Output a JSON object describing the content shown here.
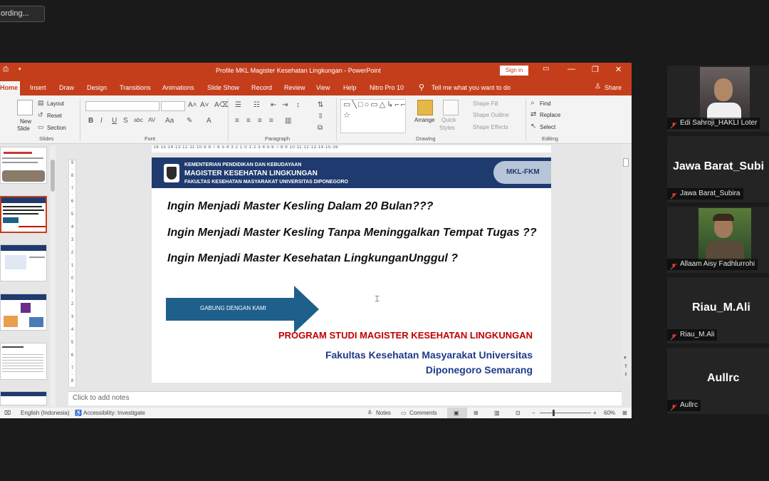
{
  "recording": {
    "label": "ording..."
  },
  "window": {
    "title": "Profile MKL Magister Kesehatan Lingkungan  -  PowerPoint",
    "signin": "Sign in"
  },
  "tabs": [
    "Home",
    "Insert",
    "Draw",
    "Design",
    "Transitions",
    "Animations",
    "Slide Show",
    "Record",
    "Review",
    "View",
    "Help",
    "Nitro Pro 10"
  ],
  "tell_me": "Tell me what you want to do",
  "share": "Share",
  "ribbon": {
    "slides_group": "Slides",
    "new_slide": "New",
    "new_slide2": "Slide",
    "layout": "Layout",
    "reset": "Reset",
    "section": "Section",
    "font_group": "Font",
    "paragraph_group": "Paragraph",
    "drawing_group": "Drawing",
    "editing_group": "Editing",
    "arrange": "Arrange",
    "quick_styles": "Quick",
    "quick_styles2": "Styles",
    "shape_fill": "Shape Fill",
    "shape_outline": "Shape Outline",
    "shape_effects": "Shape Effects",
    "find": "Find",
    "replace": "Replace",
    "select": "Select"
  },
  "ruler_h": "·16·15·14·13·12·11·10·9·8·7·6·5·4·3·2·1·0·1·2·3·4·5·6·7·8·9·10·11·12·13·14·15·16·",
  "slide": {
    "banner_line1": "KEMENTERIAN PENDIDIKAN DAN KEBUDAYAAN",
    "banner_line2": "MAGISTER KESEHATAN LINGKUNGAN",
    "banner_line3": "FAKULTAS KESEHATAN MASYARAKAT UNIVERSITAS DIPONEGORO",
    "tag": "MKL-FKM",
    "q1": "Ingin Menjadi Master Kesling Dalam 20 Bulan???",
    "q2": "Ingin Menjadi Master Kesling Tanpa Meninggalkan Tempat Tugas ??",
    "q3": "Ingin Menjadi Master Kesehatan LingkunganUnggul ?",
    "arrow_label": "GABUNG DENGAN KAMI",
    "program": "PROGRAM STUDI MAGISTER KESEHATAN LINGKUNGAN",
    "faculty_line1": "Fakultas Kesehatan Masyarakat  Universitas",
    "faculty_line2": "Diponegoro Semarang"
  },
  "notes_placeholder": "Click to add notes",
  "status": {
    "language": "English (Indonesia)",
    "accessibility": "Accessibility: Investigate",
    "notes": "Notes",
    "comments": "Comments",
    "zoom": "60%"
  },
  "participants": [
    {
      "label": "Edi Sahroji_HAKLI Loter",
      "display": ""
    },
    {
      "label": "Jawa Barat_Subira",
      "display": "Jawa  Barat_Subi"
    },
    {
      "label": "Allaam Aisy Fadhlurrohi",
      "display": ""
    },
    {
      "label": "Riau_M.Ali",
      "display": "Riau_M.Ali"
    },
    {
      "label": "Aullrc",
      "display": "Aullrc"
    }
  ],
  "colors": {
    "accent": "#c43e1c",
    "banner": "#1f3a6e",
    "arrow": "#1f5f8b",
    "program": "#c00000",
    "faculty": "#1f3a8a"
  }
}
